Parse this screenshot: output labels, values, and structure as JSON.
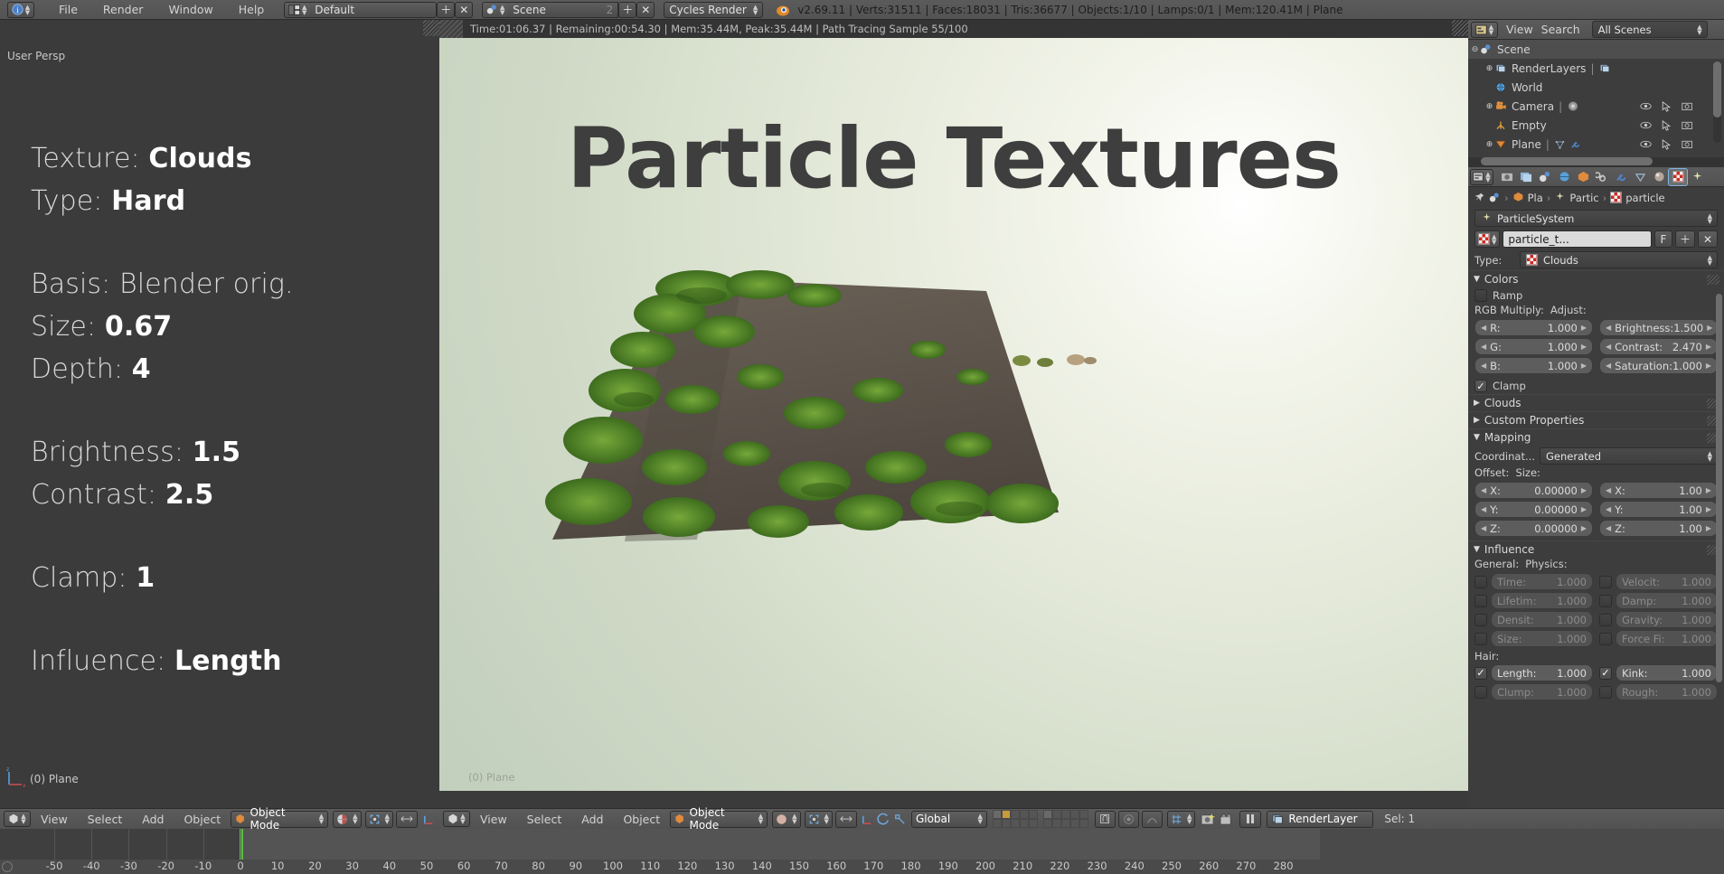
{
  "topbar": {
    "app_icon": "blender-info-icon",
    "menus": [
      "File",
      "Render",
      "Window",
      "Help"
    ],
    "screen_layout": "Default",
    "scene_name": "Scene",
    "scene_users": "2",
    "engine": "Cycles Render",
    "stats": "v2.69.11 | Verts:31511 | Faces:18031 | Tris:36677 | Objects:1/10 | Lamps:0/1 | Mem:120.41M | Plane"
  },
  "left_viewport": {
    "view_label": "User Persp",
    "object_label": "(0) Plane",
    "overlay": [
      {
        "label": "Texture:",
        "value": "Clouds"
      },
      {
        "label": "Type:",
        "value": "Hard"
      },
      {
        "label": "Basis:",
        "value": "Blender orig."
      },
      {
        "label": "Size:",
        "value": "0.67"
      },
      {
        "label": "Depth:",
        "value": "4"
      },
      {
        "label": "Brightness:",
        "value": "1.5"
      },
      {
        "label": "Contrast:",
        "value": "2.5"
      },
      {
        "label": "Clamp:",
        "value": "1"
      },
      {
        "label": "Influence:",
        "value": "Length"
      }
    ]
  },
  "render_view": {
    "stats": "Time:01:06.37 | Remaining:00:54.30 | Mem:35.44M, Peak:35.44M | Path Tracing Sample 55/100",
    "title": "Particle Textures",
    "object_label": "(0) Plane"
  },
  "outliner": {
    "header": {
      "display_mode_icon": "outliner-icon",
      "menus": [
        "View",
        "Search"
      ],
      "scope": "All Scenes"
    },
    "rows": [
      {
        "name": "Scene",
        "indent": 0,
        "icon": "scene-icon",
        "expander": "minus",
        "selected": true,
        "restrict": false
      },
      {
        "name": "RenderLayers",
        "indent": 1,
        "icon": "renderlayers-icon",
        "expander": "plus",
        "selected": false,
        "restrict": false,
        "extra": "renderlayers-data-icon"
      },
      {
        "name": "World",
        "indent": 1,
        "icon": "world-icon",
        "expander": "none",
        "selected": false,
        "restrict": false
      },
      {
        "name": "Camera",
        "indent": 1,
        "icon": "camera-icon",
        "expander": "plus",
        "selected": false,
        "restrict": true,
        "extra": "camera-data-icon"
      },
      {
        "name": "Empty",
        "indent": 1,
        "icon": "empty-icon",
        "expander": "none",
        "selected": false,
        "restrict": true
      },
      {
        "name": "Plane",
        "indent": 1,
        "icon": "mesh-icon",
        "expander": "plus",
        "selected": false,
        "restrict": true,
        "extra": "modifier-icon"
      }
    ]
  },
  "properties": {
    "tabs": [
      {
        "name": "render-tab",
        "icon": "camera-back-icon",
        "active": false
      },
      {
        "name": "render-layers-tab",
        "icon": "renderlayers-icon",
        "active": false
      },
      {
        "name": "scene-tab",
        "icon": "scene-icon",
        "active": false
      },
      {
        "name": "world-tab",
        "icon": "world-icon",
        "active": false
      },
      {
        "name": "object-tab",
        "icon": "cube-icon",
        "active": false
      },
      {
        "name": "constraints-tab",
        "icon": "chain-icon",
        "active": false
      },
      {
        "name": "modifiers-tab",
        "icon": "wrench-icon",
        "active": false
      },
      {
        "name": "data-tab",
        "icon": "mesh-data-icon",
        "active": false
      },
      {
        "name": "material-tab",
        "icon": "material-sphere-icon",
        "active": false
      },
      {
        "name": "texture-tab",
        "icon": "checker-icon",
        "active": true
      },
      {
        "name": "particles-tab",
        "icon": "particles-icon",
        "active": false
      }
    ],
    "breadcrumb": [
      "Pla",
      "Partic",
      "particle"
    ],
    "context_datablock": "ParticleSystem",
    "texture_name": "particle_t...",
    "texture_fake_user": "F",
    "texture_add": "+",
    "texture_unlink": "x",
    "type_label": "Type:",
    "type_value": "Clouds",
    "panels": {
      "colors": {
        "title": "Colors",
        "open": true,
        "ramp_label": "Ramp",
        "ramp_checked": false,
        "rgb_multiply_label": "RGB Multiply:",
        "adjust_label": "Adjust:",
        "rgb": [
          {
            "label": "R:",
            "value": "1.000"
          },
          {
            "label": "G:",
            "value": "1.000"
          },
          {
            "label": "B:",
            "value": "1.000"
          }
        ],
        "adjust": [
          {
            "label": "Brightness:",
            "value": "1.500"
          },
          {
            "label": "Contrast:",
            "value": "2.470"
          },
          {
            "label": "Saturation:",
            "value": "1.000"
          }
        ],
        "clamp_label": "Clamp",
        "clamp_checked": true
      },
      "clouds": {
        "title": "Clouds",
        "open": false
      },
      "custom_properties": {
        "title": "Custom Properties",
        "open": false
      },
      "mapping": {
        "title": "Mapping",
        "open": true,
        "coordinates_label": "Coordinat...",
        "coordinates_value": "Generated",
        "offset_label": "Offset:",
        "size_label": "Size:",
        "offset": [
          {
            "label": "X:",
            "value": "0.00000"
          },
          {
            "label": "Y:",
            "value": "0.00000"
          },
          {
            "label": "Z:",
            "value": "0.00000"
          }
        ],
        "size": [
          {
            "label": "X:",
            "value": "1.00"
          },
          {
            "label": "Y:",
            "value": "1.00"
          },
          {
            "label": "Z:",
            "value": "1.00"
          }
        ]
      },
      "influence": {
        "title": "Influence",
        "open": true,
        "general_label": "General:",
        "physics_label": "Physics:",
        "hair_label": "Hair:",
        "general": [
          {
            "label": "Time:",
            "value": "1.000",
            "checked": false
          },
          {
            "label": "Lifetim:",
            "value": "1.000",
            "checked": false
          },
          {
            "label": "Densit:",
            "value": "1.000",
            "checked": false
          },
          {
            "label": "Size:",
            "value": "1.000",
            "checked": false
          }
        ],
        "physics": [
          {
            "label": "Velocit:",
            "value": "1.000",
            "checked": false
          },
          {
            "label": "Damp:",
            "value": "1.000",
            "checked": false
          },
          {
            "label": "Gravity:",
            "value": "1.000",
            "checked": false
          },
          {
            "label": "Force Fi:",
            "value": "1.000",
            "checked": false
          }
        ],
        "hair_left": [
          {
            "label": "Length:",
            "value": "1.000",
            "checked": true
          },
          {
            "label": "Clump:",
            "value": "1.000",
            "checked": false
          }
        ],
        "hair_right": [
          {
            "label": "Kink:",
            "value": "1.000",
            "checked": true
          },
          {
            "label": "Rough:",
            "value": "1.000",
            "checked": false
          }
        ]
      }
    }
  },
  "toolbar_left": {
    "editor_icon": "3d-view-icon",
    "menus": [
      "View",
      "Select",
      "Add",
      "Object"
    ],
    "mode": "Object Mode",
    "shading_icon": "texture-shading-icon",
    "pivot_icon": "pivot-median-icon",
    "manipulator_icon": "translate-manipulator-icon"
  },
  "toolbar_right": {
    "editor_icon": "3d-view-icon",
    "menus": [
      "View",
      "Select",
      "Add",
      "Object"
    ],
    "mode": "Object Mode",
    "shading_icon": "rendered-shading-icon",
    "pivot_icon": "pivot-median-icon",
    "manipulator_icon": "translate-manipulator-icon",
    "orientation": "Global",
    "snap_icon": "snap-magnet-icon",
    "proportional_icon": "proportional-edit-icon",
    "render_layer": "RenderLayer",
    "selection_count": "Sel: 1"
  },
  "timeline": {
    "current_frame": 0,
    "ticks": [
      -50,
      -40,
      -30,
      -20,
      -10,
      0,
      10,
      20,
      30,
      40,
      50,
      60,
      70,
      80,
      90,
      100,
      110,
      120,
      130,
      140,
      150,
      160,
      170,
      180,
      190,
      200,
      210,
      220,
      230,
      240,
      250,
      260,
      270,
      280
    ],
    "playhead_color": "#5dbb46"
  },
  "colors": {
    "accent_blue": "#7fb5e8",
    "panel_bg": "#3d3d3d",
    "header_bg": "#545454",
    "text": "#d3d3d3",
    "checker_red": "#cc2a22",
    "green_playhead": "#5dbb46"
  }
}
